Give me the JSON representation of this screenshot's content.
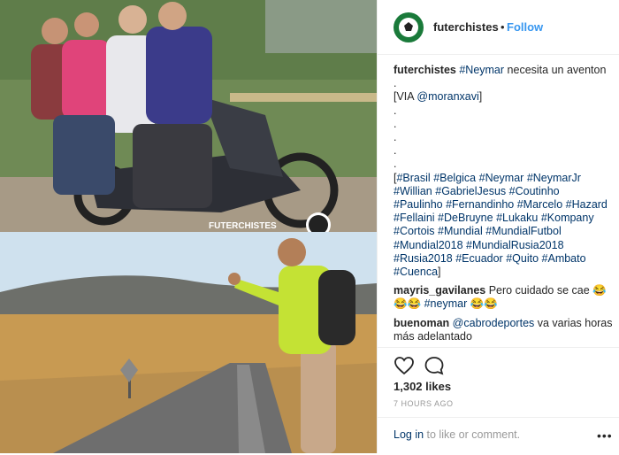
{
  "post": {
    "username": "futerchistes",
    "separator": "•",
    "follow_label": "Follow",
    "watermark": "FUTERCHISTES",
    "caption": {
      "author": "futerchistes",
      "lines": [
        [
          {
            "t": "#Neymar",
            "tag": true
          },
          {
            "t": " necesita un aventon",
            "tag": false
          }
        ],
        [
          {
            "t": ".",
            "tag": false
          }
        ],
        [
          {
            "t": "[VIA ",
            "tag": false
          },
          {
            "t": "@moranxavi",
            "tag": true
          },
          {
            "t": "]",
            "tag": false
          }
        ],
        [
          {
            "t": ".",
            "tag": false
          }
        ],
        [
          {
            "t": ".",
            "tag": false
          }
        ],
        [
          {
            "t": ".",
            "tag": false
          }
        ],
        [
          {
            "t": ".",
            "tag": false
          }
        ],
        [
          {
            "t": ".",
            "tag": false
          }
        ],
        [
          {
            "t": "[",
            "tag": false
          },
          {
            "t": "#Brasil",
            "tag": true
          },
          {
            "t": " ",
            "tag": false
          },
          {
            "t": "#Belgica",
            "tag": true
          },
          {
            "t": " ",
            "tag": false
          },
          {
            "t": "#Neymar",
            "tag": true
          },
          {
            "t": " ",
            "tag": false
          },
          {
            "t": "#NeymarJr",
            "tag": true
          }
        ],
        [
          {
            "t": "#Willian",
            "tag": true
          },
          {
            "t": " ",
            "tag": false
          },
          {
            "t": "#GabrielJesus",
            "tag": true
          },
          {
            "t": " ",
            "tag": false
          },
          {
            "t": "#Coutinho",
            "tag": true
          }
        ],
        [
          {
            "t": "#Paulinho",
            "tag": true
          },
          {
            "t": " ",
            "tag": false
          },
          {
            "t": "#Fernandinho",
            "tag": true
          },
          {
            "t": " ",
            "tag": false
          },
          {
            "t": "#Marcelo",
            "tag": true
          },
          {
            "t": " ",
            "tag": false
          },
          {
            "t": "#Hazard",
            "tag": true
          }
        ],
        [
          {
            "t": "#Fellaini",
            "tag": true
          },
          {
            "t": " ",
            "tag": false
          },
          {
            "t": "#DeBruyne",
            "tag": true
          },
          {
            "t": " ",
            "tag": false
          },
          {
            "t": "#Lukaku",
            "tag": true
          },
          {
            "t": " ",
            "tag": false
          },
          {
            "t": "#Kompany",
            "tag": true
          }
        ],
        [
          {
            "t": "#Cortois",
            "tag": true
          },
          {
            "t": " ",
            "tag": false
          },
          {
            "t": "#Mundial",
            "tag": true
          },
          {
            "t": " ",
            "tag": false
          },
          {
            "t": "#MundialFutbol",
            "tag": true
          }
        ],
        [
          {
            "t": "#Mundial2018",
            "tag": true
          },
          {
            "t": " ",
            "tag": false
          },
          {
            "t": "#MundialRusia2018",
            "tag": true
          }
        ],
        [
          {
            "t": "#Rusia2018",
            "tag": true
          },
          {
            "t": " ",
            "tag": false
          },
          {
            "t": "#Ecuador",
            "tag": true
          },
          {
            "t": " ",
            "tag": false
          },
          {
            "t": "#Quito",
            "tag": true
          },
          {
            "t": " ",
            "tag": false
          },
          {
            "t": "#Ambato",
            "tag": true
          }
        ],
        [
          {
            "t": "#Cuenca",
            "tag": true
          },
          {
            "t": "]",
            "tag": false
          }
        ]
      ]
    },
    "comments": [
      {
        "user": "mayris_gavilanes",
        "parts": [
          {
            "t": "Pero cuidado se cae 😂",
            "tag": false
          },
          {
            "t": "\n😂😂 ",
            "tag": false
          },
          {
            "t": "#neymar",
            "tag": true
          },
          {
            "t": " 😂😂",
            "tag": false
          }
        ]
      },
      {
        "user": "buenoman",
        "parts": [
          {
            "t": "@cabrodeportes",
            "tag": true
          },
          {
            "t": " va varias horas más adelantado",
            "tag": false
          }
        ]
      }
    ],
    "likes": "1,302 likes",
    "time": "7 HOURS AGO",
    "login_link": "Log in",
    "login_rest": " to like or comment.",
    "more": "•••",
    "icons": {
      "like": "heart-icon",
      "comment": "comment-icon",
      "options": "more-options-icon"
    }
  }
}
